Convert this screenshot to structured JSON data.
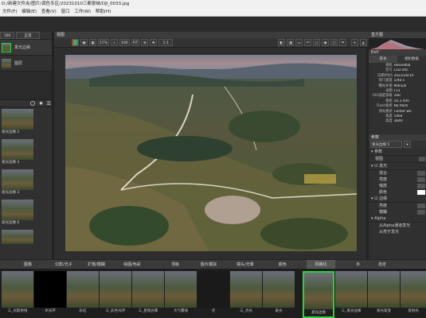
{
  "title": "D:/新建文件夹/图片/调色专区/20231010三都景峡/DJI_0033.jpg",
  "menu": [
    "文件(F)",
    "编辑(E)",
    "查看(V)",
    "窗口",
    "工作(W)",
    "帮助(H)"
  ],
  "left": {
    "zoom_value": "100",
    "blend_mode": "正常",
    "layers": [
      {
        "label": "发光边缘"
      },
      {
        "label": "图层"
      }
    ],
    "presets": [
      {
        "label": "发光边缘 2"
      },
      {
        "label": "发光边缘 4"
      },
      {
        "label": "发光边缘 3"
      },
      {
        "label": "发光边缘 6"
      },
      {
        "label": ""
      }
    ]
  },
  "viewer": {
    "header": "视图",
    "zoom_buttons": [
      "17%",
      "100",
      "FIT"
    ],
    "zoom_select": "1:1",
    "photo_alt": "aerial countryside photo"
  },
  "right": {
    "histogram_label": "直方图",
    "exif_label": "Exif",
    "tabs": [
      "基本",
      "相机数据"
    ],
    "exif": [
      {
        "k": "相机",
        "v": "Hasselbla"
      },
      {
        "k": "型号",
        "v": "L1D-20c"
      },
      {
        "k": "日期/时间",
        "v": "2023/10/10"
      },
      {
        "k": "快门速度",
        "v": "1/40 s"
      },
      {
        "k": "曝光补偿",
        "v": "Manual"
      },
      {
        "k": "光圈",
        "v": "F11"
      },
      {
        "k": "ISO速度等级",
        "v": "100"
      },
      {
        "k": "焦距",
        "v": "10.3 mm"
      },
      {
        "k": "Flash使用",
        "v": "No flash"
      },
      {
        "k": "测光模式",
        "v": "Center we"
      },
      {
        "k": "宽度",
        "v": "5464"
      },
      {
        "k": "高度",
        "v": "3640"
      }
    ],
    "params_label": "参数",
    "param_name": "发光边缘 5",
    "sections": [
      {
        "label": "参数"
      },
      {
        "label": "视图"
      },
      {
        "label": "发光"
      }
    ],
    "glow_rows": [
      "混合",
      "亮度",
      "缩放",
      "颜色"
    ],
    "edge_label": "边缘",
    "edge_rows": [
      "亮度",
      "模糊"
    ],
    "alpha_label": "Alpha",
    "alpha_rows": [
      "从Alpha通道发光",
      "从亮于发光"
    ]
  },
  "filter_tabs": [
    "图像",
    "幻影/光子",
    "扩散/模糊",
    "绘图/色彩",
    "顶级",
    "胶片模拟",
    "镜头/光晕",
    "颜色",
    "风格化",
    "外",
    "自定"
  ],
  "filmstrip": [
    {
      "label": "三_光影射线"
    },
    {
      "label": "水光环"
    },
    {
      "label": "彩虹"
    },
    {
      "label": "三_彩色光环"
    },
    {
      "label": "三_星暗光晕"
    },
    {
      "label": "大气雾线"
    },
    {
      "label": "点"
    },
    {
      "label": "三_点光"
    },
    {
      "label": "发光"
    },
    {
      "label": "发光边缘"
    },
    {
      "label": "三_发光边缘"
    },
    {
      "label": "发光渐变"
    },
    {
      "label": "反射光"
    }
  ],
  "colors": {
    "accent": "#2fd23a",
    "panel": "#303030",
    "bg": "#2b2b2b"
  }
}
